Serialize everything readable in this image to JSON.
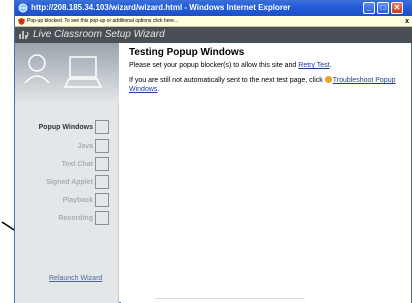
{
  "window": {
    "title": "http://208.185.34.103/wizard/wizard.html - Windows Internet Explorer",
    "minimize_label": "_",
    "maximize_label": "□",
    "close_label": "✕"
  },
  "infobar": {
    "message": "Pop-up blocked. To see this pop-up or additional options click here...",
    "close_label": "x"
  },
  "wizard": {
    "title": "Live Classroom Setup Wizard"
  },
  "steps": [
    {
      "label": "Popup Windows",
      "active": true
    },
    {
      "label": "Java",
      "active": false
    },
    {
      "label": "Text Chat",
      "active": false
    },
    {
      "label": "Signed Applet",
      "active": false
    },
    {
      "label": "Playback",
      "active": false
    },
    {
      "label": "Recording",
      "active": false
    }
  ],
  "relaunch_label": "Relaunch Wizard",
  "main": {
    "title": "Testing Popup Windows",
    "para1_text": "Please set your popup blocker(s) to allow this site and ",
    "para1_link": "Retry Test",
    "para1_end": ".",
    "para2_text": "If you are still not automatically sent to the next test page, click ",
    "para2_link": "Troubleshoot Popup Windows",
    "para2_end": "."
  },
  "colors": {
    "header_bg": "#4a4f55",
    "sidebar_bg": "#e4e7ea",
    "link": "#1a3f8f",
    "titlebar": "#245edb"
  },
  "icons": {
    "window": "ie-icon",
    "infobar": "shield-icon",
    "header": "logo-icon",
    "tip": "tip-icon"
  }
}
